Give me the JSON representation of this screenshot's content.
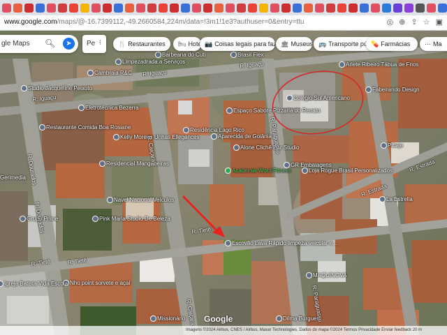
{
  "browser": {
    "url_host": "www.google.com",
    "url_path": "/maps/@-16.7399112,-49.2660584,224m/data=!3m1!1e3?authuser=0&entry=ttu",
    "tab_colors": [
      "#e04f5f",
      "#e8603c",
      "#cc2e2e",
      "#3a6fd8",
      "#e04f5f",
      "#d03d3d",
      "#ea4335",
      "#f4b400",
      "#e04f5f",
      "#cc2e2e",
      "#3a6fd8",
      "#e8603c",
      "#e04f5f",
      "#d03d3d",
      "#ea4335",
      "#cc2e2e",
      "#3a6fd8",
      "#e04f5f",
      "#cc2e2e",
      "#e8603c",
      "#e04f5f",
      "#d03d3d",
      "#ea4335",
      "#f4b400",
      "#e04f5f",
      "#cc2e2e",
      "#3a6fd8",
      "#e8603c",
      "#e04f5f",
      "#d03d3d",
      "#ea4335",
      "#cc2e2e",
      "#3a6fd8",
      "#e04f5f",
      "#2b7bd8",
      "#6a3fd8",
      "#8a3fd8",
      "#555555",
      "#e04f5f",
      "#3a6fd8",
      "#cc2e2e",
      "#e04f5f"
    ]
  },
  "search": {
    "text": "gle Maps",
    "search_icon": "search-icon",
    "directions_icon": "directions-icon"
  },
  "layer_box": {
    "label": "Pe",
    "more": "⁝"
  },
  "chips": [
    {
      "icon": "restaurant-icon",
      "glyph": "🍴",
      "label": "Restaurantes"
    },
    {
      "icon": "hotel-icon",
      "glyph": "🛏",
      "label": "Hotéis"
    },
    {
      "icon": "camera-icon",
      "glyph": "📷",
      "label": "Coisas legais para faz…"
    },
    {
      "icon": "museum-icon",
      "glyph": "🏛",
      "label": "Museus"
    },
    {
      "icon": "transit-icon",
      "glyph": "🚌",
      "label": "Transporte público"
    },
    {
      "icon": "pharmacy-icon",
      "glyph": "💊",
      "label": "Farmácias"
    },
    {
      "icon": "more-icon",
      "glyph": "···",
      "label": "Ma"
    }
  ],
  "places": [
    {
      "name": "Barbearia do Cuti",
      "color": "#ffffff"
    },
    {
      "name": "Brasil Flex",
      "color": "#ffffff"
    },
    {
      "name": "Limpezadrada.a Serviços",
      "color": "#ffffff"
    },
    {
      "name": "Cambraia R&C",
      "color": "#ffffff"
    },
    {
      "name": "Studio Jacqueline Peixoto",
      "color": "#ffffff"
    },
    {
      "name": "Eletrotécnica Bezerra",
      "color": "#ffffff"
    },
    {
      "name": "Restaurante Comida Boa Rosiane",
      "color": "#ffffff"
    },
    {
      "name": "Kelly Moreira Unhas Ellegances",
      "color": "#ffffff"
    },
    {
      "name": "Residencial Mangabeiras",
      "color": "#ffffff"
    },
    {
      "name": "Residência Lago Rico",
      "color": "#ffffff"
    },
    {
      "name": "Espaço Sabore Pizzaria do Renato",
      "color": "#ffffff"
    },
    {
      "name": "Aparecida de Goiânia",
      "color": "#ffffff"
    },
    {
      "name": "Alone Clichê Bar Studio",
      "color": "#ffffff"
    },
    {
      "name": "Academia Word Fitness",
      "color": "#5ecb6a"
    },
    {
      "name": "Colégio Sul Americano",
      "color": "#ffffff"
    },
    {
      "name": "Arlete Ribeiro Tábua de Frios",
      "color": "#ffffff"
    },
    {
      "name": "Fabeirando Design",
      "color": "#ffffff"
    },
    {
      "name": "Pittaje",
      "color": "#ffffff"
    },
    {
      "name": "GR Embalagens",
      "color": "#ffffff"
    },
    {
      "name": "Loja Rogue Brasil Personalizados",
      "color": "#ffffff"
    },
    {
      "name": "La Estrella",
      "color": "#ffffff"
    },
    {
      "name": "Navel Nacional Veículos",
      "color": "#ffffff"
    },
    {
      "name": "Pink Maria Studio De Beleza",
      "color": "#ffffff"
    },
    {
      "name": "Grupo Prime",
      "color": "#ffffff"
    },
    {
      "name": "Gerimedia",
      "color": "#ffffff"
    },
    {
      "name": "Escovão Lava Rápido limpeza veicular e ...",
      "color": "#ffffff"
    },
    {
      "name": "Nho point sorvete e açaí",
      "color": "#ffffff"
    },
    {
      "name": "Igreja Batista Vida Escola",
      "color": "#ffffff"
    },
    {
      "name": "MAQUINOVA",
      "color": "#ffffff"
    },
    {
      "name": "Missionário",
      "color": "#ffffff"
    },
    {
      "name": "Dilma Burguer",
      "color": "#ffffff"
    }
  ],
  "streets": [
    {
      "name": "R. Iguaçu"
    },
    {
      "name": "R. Iguaçu"
    },
    {
      "name": "R. Iguaçu"
    },
    {
      "name": "R. Dourados"
    },
    {
      "name": "R. Dourados"
    },
    {
      "name": "R. Caiçara"
    },
    {
      "name": "R. Paraguassu"
    },
    {
      "name": "R. Tietê"
    },
    {
      "name": "R. Tietê"
    },
    {
      "name": "R. Tietê"
    },
    {
      "name": "R. Estrada"
    },
    {
      "name": "R. Estrada"
    },
    {
      "name": "R. Paraguassu"
    },
    {
      "name": "R. Caiçara"
    }
  ],
  "attribution": "Imagens ©2024 Airbus, CNES / Airbus, Maxar Technologies, Dados do mapa ©2024   Termos   Privacidade   Enviar feedback   20 m",
  "google_logo": "Google",
  "annotation": {
    "arrow_color": "#e8231b",
    "circle_color": "#d42a2a"
  }
}
